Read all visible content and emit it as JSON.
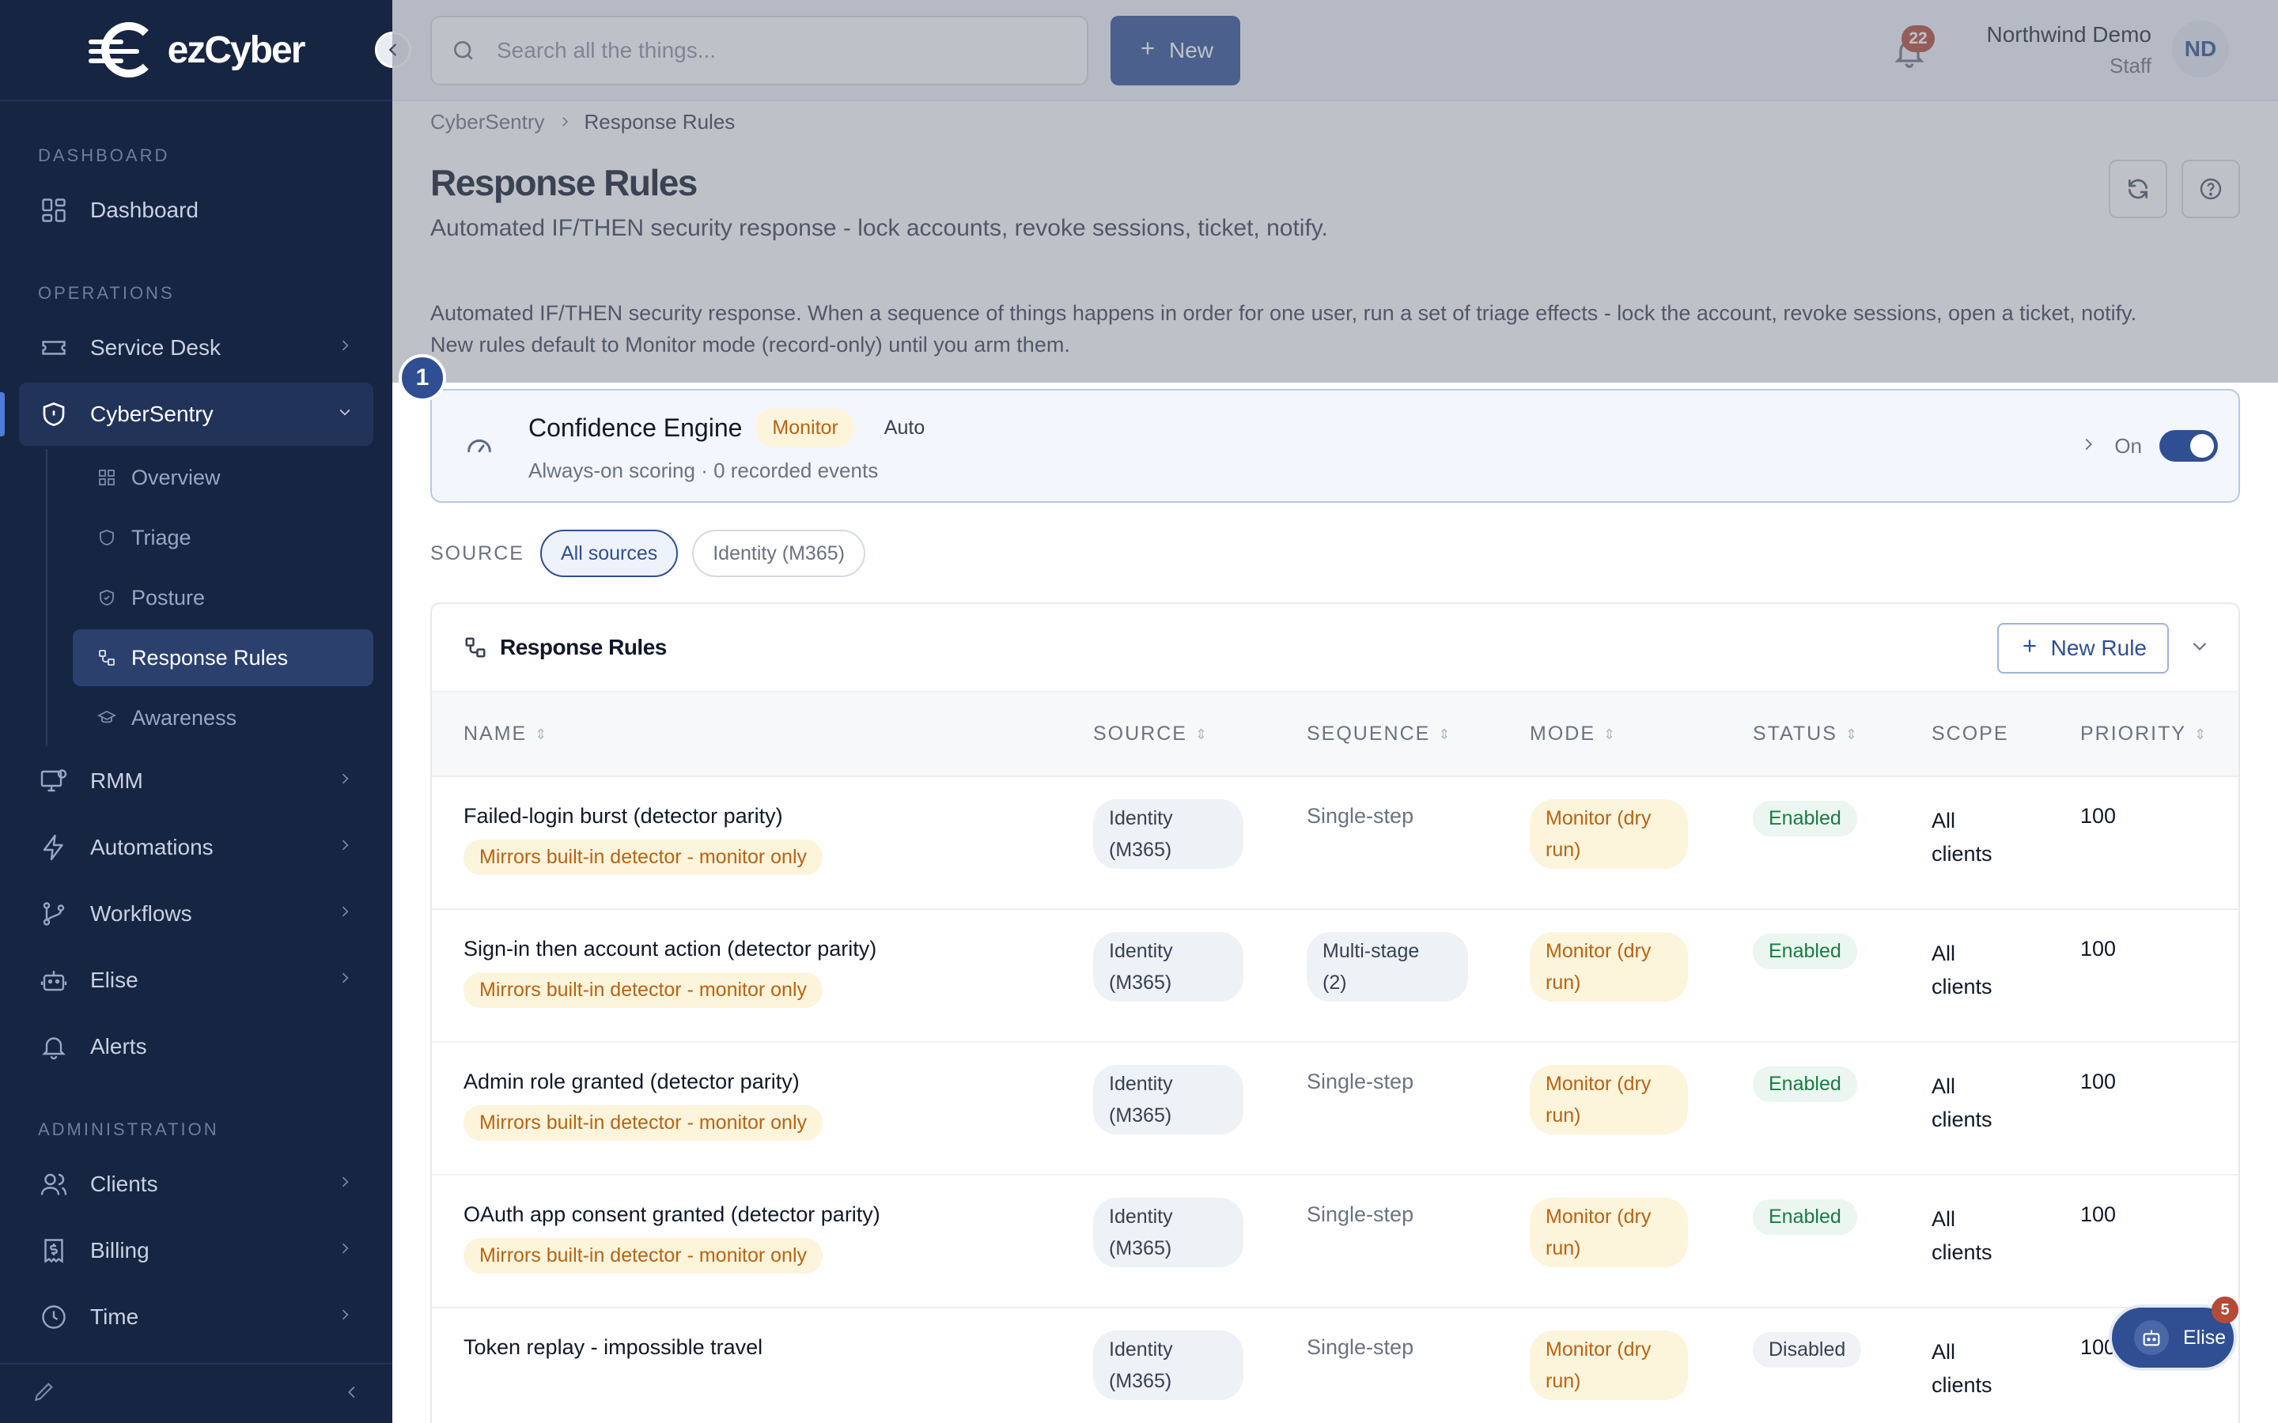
{
  "brand": {
    "logo_text_1": "ez",
    "logo_text_2": "Cyber"
  },
  "sidebar": {
    "sections": {
      "dashboard": "DASHBOARD",
      "operations": "OPERATIONS",
      "administration": "ADMINISTRATION"
    },
    "items": {
      "dashboard": "Dashboard",
      "service_desk": "Service Desk",
      "cybersentry": "CyberSentry",
      "rmm": "RMM",
      "automations": "Automations",
      "workflows": "Workflows",
      "elise": "Elise",
      "alerts": "Alerts",
      "clients": "Clients",
      "billing": "Billing",
      "time": "Time"
    },
    "sub_items": {
      "overview": "Overview",
      "triage": "Triage",
      "posture": "Posture",
      "response_rules": "Response Rules",
      "awareness": "Awareness"
    }
  },
  "topbar": {
    "search_placeholder": "Search all the things...",
    "new_label": "New",
    "notification_count": "22",
    "user_name": "Northwind Demo",
    "user_role": "Staff",
    "avatar_initials": "ND"
  },
  "breadcrumb": {
    "parent": "CyberSentry",
    "current": "Response Rules"
  },
  "page": {
    "title": "Response Rules",
    "subtitle": "Automated IF/THEN security response - lock accounts, revoke sessions, ticket, notify.",
    "info_line1": "Automated IF/THEN security response. When a sequence of things happens in order for one user, run a set of triage effects - lock the account, revoke sessions, open a ticket, notify.",
    "info_line2": "New rules default to Monitor mode (record-only) until you arm them."
  },
  "engine": {
    "step": "1",
    "title": "Confidence Engine",
    "badge_monitor": "Monitor",
    "badge_auto": "Auto",
    "meta": "Always-on scoring · 0 recorded events",
    "toggle_label": "On",
    "enabled": true
  },
  "filters": {
    "label": "SOURCE",
    "options": [
      "All sources",
      "Identity (M365)"
    ],
    "selected": "All sources"
  },
  "rules_card": {
    "title": "Response Rules",
    "new_rule_label": "New Rule",
    "columns": [
      "NAME",
      "SOURCE",
      "SEQUENCE",
      "MODE",
      "STATUS",
      "SCOPE",
      "PRIORITY"
    ],
    "rows": [
      {
        "name": "Failed-login burst (detector parity)",
        "tag": "Mirrors built-in detector - monitor only",
        "source_1": "Identity",
        "source_2": "(M365)",
        "sequence": "Single-step",
        "sequence_2": "",
        "mode_1": "Monitor (dry",
        "mode_2": "run)",
        "status": "Enabled",
        "scope_1": "All",
        "scope_2": "clients",
        "priority": "100"
      },
      {
        "name": "Sign-in then account action (detector parity)",
        "tag": "Mirrors built-in detector - monitor only",
        "source_1": "Identity",
        "source_2": "(M365)",
        "sequence": "Multi-stage",
        "sequence_2": "(2)",
        "mode_1": "Monitor (dry",
        "mode_2": "run)",
        "status": "Enabled",
        "scope_1": "All",
        "scope_2": "clients",
        "priority": "100"
      },
      {
        "name": "Admin role granted (detector parity)",
        "tag": "Mirrors built-in detector - monitor only",
        "source_1": "Identity",
        "source_2": "(M365)",
        "sequence": "Single-step",
        "sequence_2": "",
        "mode_1": "Monitor (dry",
        "mode_2": "run)",
        "status": "Enabled",
        "scope_1": "All",
        "scope_2": "clients",
        "priority": "100"
      },
      {
        "name": "OAuth app consent granted (detector parity)",
        "tag": "Mirrors built-in detector - monitor only",
        "source_1": "Identity",
        "source_2": "(M365)",
        "sequence": "Single-step",
        "sequence_2": "",
        "mode_1": "Monitor (dry",
        "mode_2": "run)",
        "status": "Enabled",
        "scope_1": "All",
        "scope_2": "clients",
        "priority": "100"
      },
      {
        "name": "Token replay - impossible travel",
        "tag": "",
        "source_1": "Identity",
        "source_2": "(M365)",
        "sequence": "Single-step",
        "sequence_2": "",
        "mode_1": "Monitor (dry",
        "mode_2": "run)",
        "status": "Disabled",
        "scope_1": "All",
        "scope_2": "clients",
        "priority": "100"
      }
    ]
  },
  "assistant": {
    "label": "Elise",
    "count": "5"
  },
  "colors": {
    "sidebar_bg": "#162542",
    "accent": "#2f4f92",
    "warning": "#b86411",
    "success": "#1c7a45",
    "badge_red": "#b54a37"
  }
}
